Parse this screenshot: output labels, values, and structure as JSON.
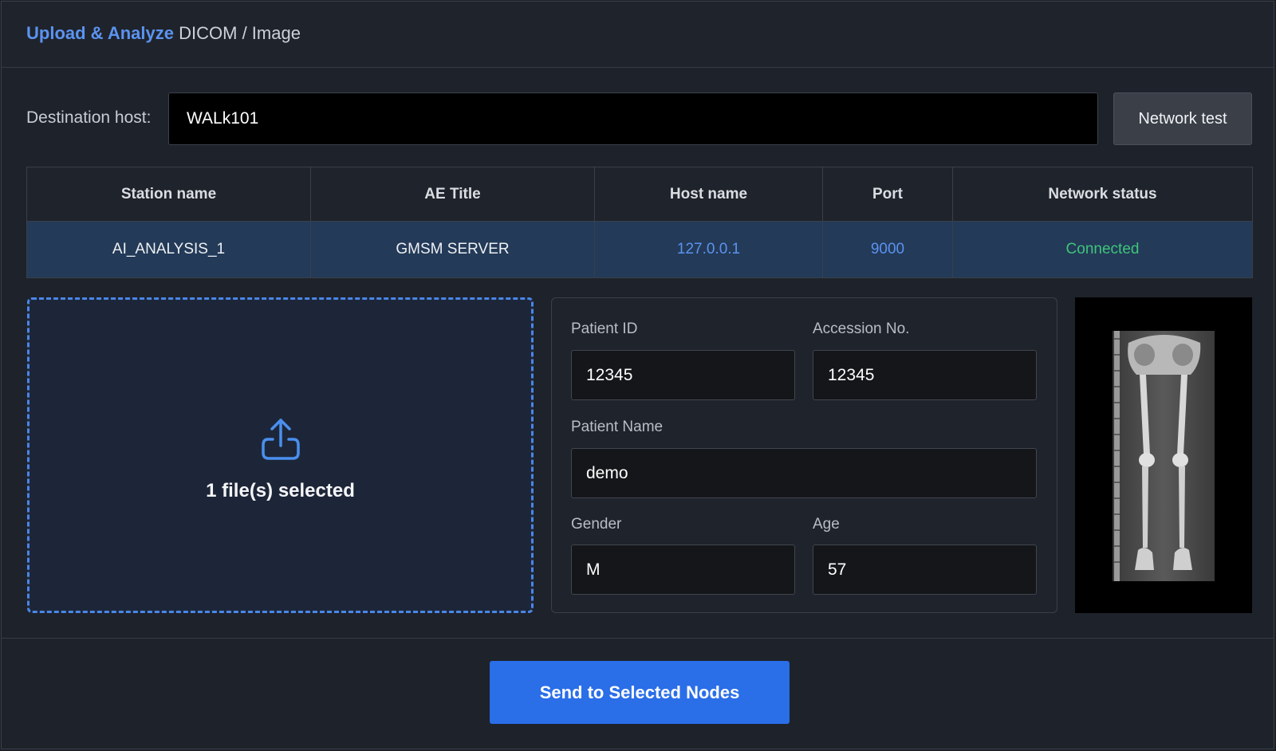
{
  "header": {
    "title_accent": "Upload & Analyze",
    "title_rest": "DICOM / Image"
  },
  "destination": {
    "label": "Destination host:",
    "value": "WALk101",
    "network_test_label": "Network test"
  },
  "nodes_table": {
    "columns": [
      "Station name",
      "AE Title",
      "Host name",
      "Port",
      "Network status"
    ],
    "rows": [
      {
        "station": "AI_ANALYSIS_1",
        "ae_title": "GMSM SERVER",
        "host": "127.0.0.1",
        "port": "9000",
        "status": "Connected"
      }
    ]
  },
  "upload": {
    "icon": "upload-icon",
    "status_text": "1 file(s) selected"
  },
  "patient_form": {
    "patient_id_label": "Patient ID",
    "patient_id": "12345",
    "accession_label": "Accession No.",
    "accession": "12345",
    "patient_name_label": "Patient Name",
    "patient_name": "demo",
    "gender_label": "Gender",
    "gender": "M",
    "age_label": "Age",
    "age": "57"
  },
  "actions": {
    "send_label": "Send to Selected Nodes"
  },
  "colors": {
    "accent": "#5b93f0",
    "connected": "#3fc47a",
    "primary_button": "#2a6ee8"
  }
}
